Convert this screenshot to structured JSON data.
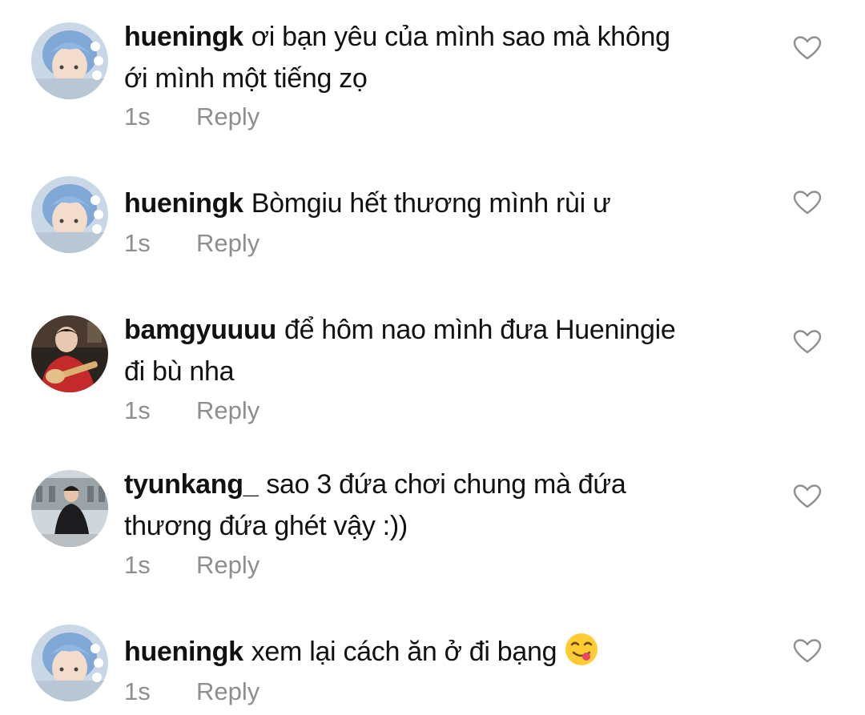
{
  "comments": [
    {
      "username": "hueningk",
      "text_lines": [
        "ơi bạn yêu của mình sao mà không",
        "ới mình một tiếng zọ"
      ],
      "time": "1s",
      "reply_label": "Reply",
      "avatar_icon": "user-avatar-blue-hair"
    },
    {
      "username": "hueningk",
      "text_lines": [
        "Bòmgiu hết thương mình rùi ư"
      ],
      "time": "1s",
      "reply_label": "Reply",
      "avatar_icon": "user-avatar-blue-hair"
    },
    {
      "username": "bamgyuuuu",
      "text_lines": [
        "để hôm nao mình đưa Hueningie",
        "đi bù nha"
      ],
      "time": "1s",
      "reply_label": "Reply",
      "avatar_icon": "user-avatar-guitar"
    },
    {
      "username": "tyunkang_",
      "text_lines": [
        "sao 3 đứa chơi chung mà đứa",
        "thương đứa ghét vậy :))"
      ],
      "time": "1s",
      "reply_label": "Reply",
      "avatar_icon": "user-avatar-street"
    },
    {
      "username": "hueningk",
      "text_lines": [
        "xem lại cách ăn ở đi bạng"
      ],
      "time": "1s",
      "reply_label": "Reply",
      "avatar_icon": "user-avatar-blue-hair",
      "emoji_icon": "yum-face-emoji"
    }
  ],
  "colors": {
    "meta": "#8e8e8e",
    "text": "#111111",
    "heart_outline": "#8e8e8e"
  }
}
